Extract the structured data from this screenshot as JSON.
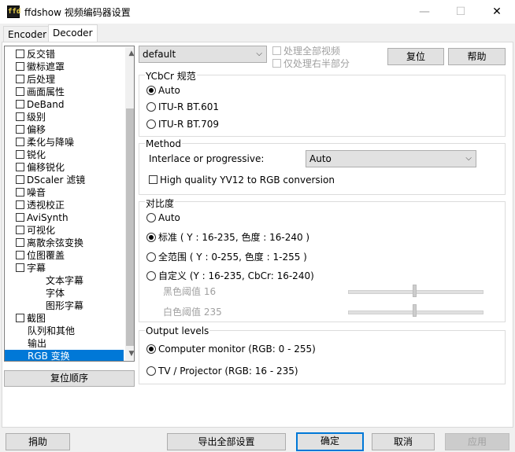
{
  "window": {
    "title": "ffdshow 视频编码器设置",
    "icon_label": "ffd"
  },
  "tabs": [
    {
      "label": "Encoder"
    },
    {
      "label": "Decoder"
    }
  ],
  "tree": {
    "items": [
      {
        "label": "反交错",
        "checkbox": true
      },
      {
        "label": "徽标遮罩",
        "checkbox": true
      },
      {
        "label": "后处理",
        "checkbox": true
      },
      {
        "label": "画面属性",
        "checkbox": true
      },
      {
        "label": "DeBand",
        "checkbox": true
      },
      {
        "label": "级别",
        "checkbox": true
      },
      {
        "label": "偏移",
        "checkbox": true
      },
      {
        "label": "柔化与降噪",
        "checkbox": true
      },
      {
        "label": "锐化",
        "checkbox": true
      },
      {
        "label": "偏移锐化",
        "checkbox": true
      },
      {
        "label": "DScaler 滤镜",
        "checkbox": true
      },
      {
        "label": "噪音",
        "checkbox": true
      },
      {
        "label": "透视校正",
        "checkbox": true
      },
      {
        "label": "AviSynth",
        "checkbox": true
      },
      {
        "label": "可视化",
        "checkbox": true
      },
      {
        "label": "离散余弦变换",
        "checkbox": true
      },
      {
        "label": "位图覆盖",
        "checkbox": true
      },
      {
        "label": "字幕",
        "checkbox": true
      },
      {
        "label": "文本字幕",
        "checkbox": false,
        "indent": true
      },
      {
        "label": "字体",
        "checkbox": false,
        "indent": true
      },
      {
        "label": "图形字幕",
        "checkbox": false,
        "indent": true
      },
      {
        "label": "截图",
        "checkbox": true
      },
      {
        "label": "队列和其他",
        "checkbox": false
      },
      {
        "label": "输出",
        "checkbox": false
      },
      {
        "label": "RGB 变换",
        "checkbox": false,
        "selected": true
      }
    ]
  },
  "reset_order_label": "复位顺序",
  "preset": {
    "value": "default"
  },
  "process_whole": "处理全部视频",
  "process_right_half": "仅处理右半部分",
  "reset_label": "复位",
  "help_label": "帮助",
  "ycbcr": {
    "title": "YCbCr 规范",
    "options": [
      "Auto",
      "ITU-R BT.601",
      "ITU-R BT.709"
    ],
    "selected": 0
  },
  "method": {
    "title": "Method",
    "interlace_label": "Interlace or progressive:",
    "interlace_value": "Auto",
    "hq_label": "High quality YV12 to RGB conversion"
  },
  "contrast": {
    "title": "对比度",
    "options": [
      "Auto",
      "标准 ( Y : 16-235, 色度 : 16-240 )",
      "全范围 ( Y : 0-255, 色度 : 1-255 )",
      "自定义 (Y : 16-235, CbCr: 16-240)"
    ],
    "selected": 1,
    "black_label": "黑色阈值 16",
    "white_label": "白色阈值 235",
    "black_value": 16,
    "white_value": 235
  },
  "output": {
    "title": "Output levels",
    "options": [
      "Computer monitor  (RGB: 0 - 255)",
      "TV / Projector  (RGB: 16 - 235)"
    ],
    "selected": 0
  },
  "footer": {
    "donate": "捐助",
    "export": "导出全部设置",
    "ok": "确定",
    "cancel": "取消",
    "apply": "应用"
  },
  "colors": {
    "selection": "#0078d7",
    "face": "#f0f0f0",
    "disabled": "#a0a0a0"
  }
}
